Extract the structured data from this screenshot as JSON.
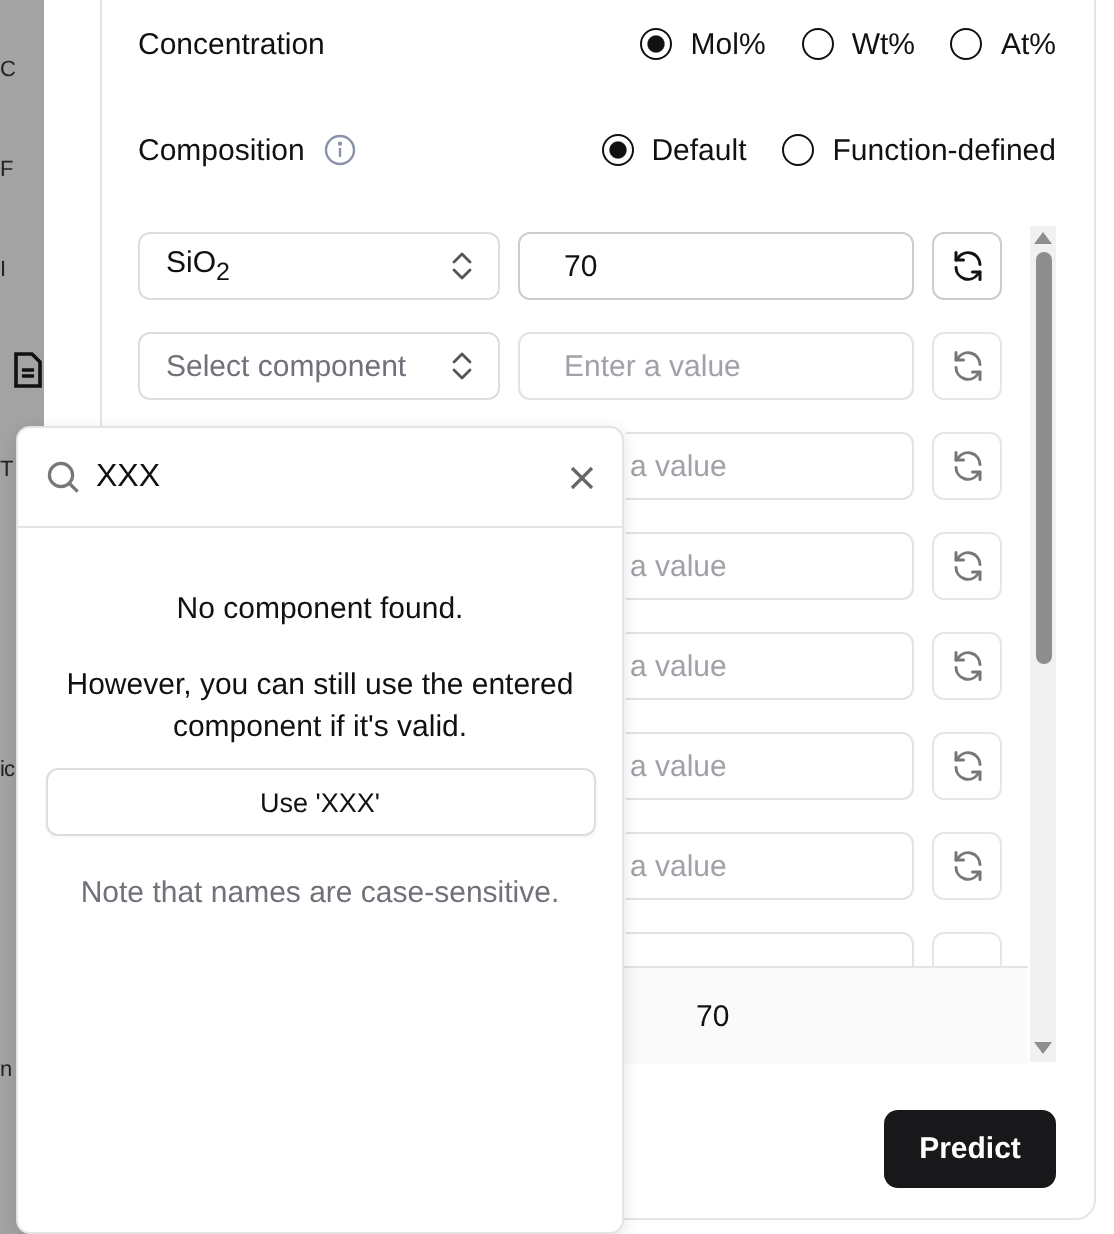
{
  "sidebar": {
    "items": [
      {
        "kind": "text",
        "label": "C"
      },
      {
        "kind": "text",
        "label": "F"
      },
      {
        "kind": "text",
        "label": "I"
      },
      {
        "kind": "doc"
      },
      {
        "kind": "text",
        "label": "T"
      },
      {
        "kind": "blank"
      },
      {
        "kind": "blank"
      },
      {
        "kind": "text",
        "label": "ic"
      },
      {
        "kind": "blank"
      },
      {
        "kind": "blank"
      },
      {
        "kind": "text",
        "label": "n"
      }
    ]
  },
  "concentration": {
    "label": "Concentration",
    "options": [
      {
        "label": "Mol%",
        "selected": true
      },
      {
        "label": "Wt%",
        "selected": false
      },
      {
        "label": "At%",
        "selected": false
      }
    ]
  },
  "composition": {
    "label": "Composition",
    "options": [
      {
        "label": "Default",
        "selected": true
      },
      {
        "label": "Function-defined",
        "selected": false
      }
    ]
  },
  "component_rows": [
    {
      "kind": "full",
      "component": "SiO$_{2}$",
      "value": "70"
    },
    {
      "kind": "full",
      "placeholder_component": "Select component",
      "placeholder_value": "Enter a value"
    },
    {
      "kind": "covered",
      "placeholder_value": "a value"
    },
    {
      "kind": "covered",
      "placeholder_value": "a value"
    },
    {
      "kind": "covered",
      "placeholder_value": "a value"
    },
    {
      "kind": "covered",
      "placeholder_value": "a value"
    },
    {
      "kind": "covered",
      "placeholder_value": "a value"
    },
    {
      "kind": "cut"
    }
  ],
  "total": "70",
  "predict_button": "Predict",
  "popover": {
    "query": "XXX",
    "message": "No component found.",
    "hint": "However, you can still use the entered component if it's valid.",
    "use_button": "Use 'XXX'",
    "note": "Note that names are case-sensitive."
  }
}
